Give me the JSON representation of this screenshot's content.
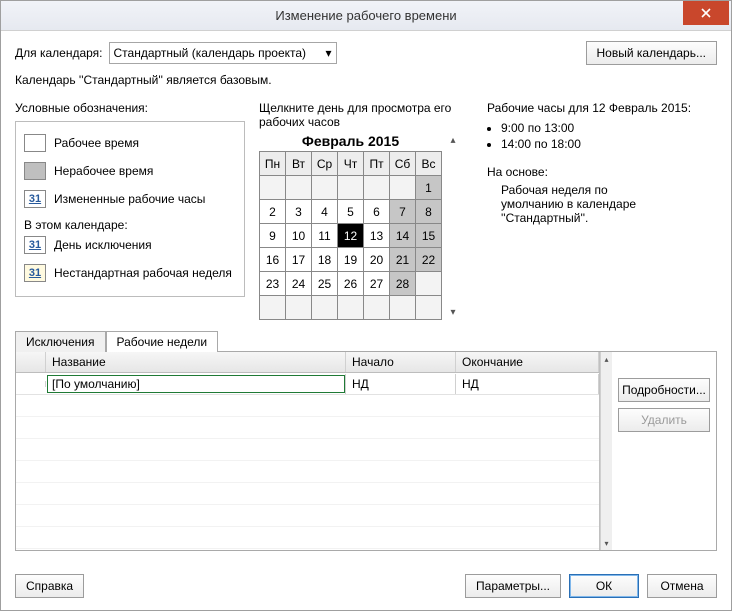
{
  "window": {
    "title": "Изменение рабочего времени"
  },
  "topbar": {
    "for_calendar_label": "Для календаря:",
    "calendar_selected": "Стандартный (календарь проекта)",
    "new_calendar_btn": "Новый календарь...",
    "base_text": "Календарь ''Стандартный'' является базовым."
  },
  "legend": {
    "header": "Условные обозначения:",
    "working": "Рабочее время",
    "nonworking": "Нерабочее время",
    "changed": "Измененные рабочие часы",
    "in_this_calendar": "В этом календаре:",
    "exception_day": "День исключения",
    "nonstandard_week": "Нестандартная рабочая неделя",
    "num": "31"
  },
  "calendar": {
    "hint": "Щелкните день для просмотра его рабочих часов",
    "month_title": "Февраль 2015",
    "weekdays": [
      "Пн",
      "Вт",
      "Ср",
      "Чт",
      "Пт",
      "Сб",
      "Вс"
    ],
    "weeks": [
      [
        {
          "d": "",
          "cls": "empty"
        },
        {
          "d": "",
          "cls": "empty"
        },
        {
          "d": "",
          "cls": "empty"
        },
        {
          "d": "",
          "cls": "empty"
        },
        {
          "d": "",
          "cls": "empty"
        },
        {
          "d": "",
          "cls": "empty"
        },
        {
          "d": "1",
          "cls": "wk"
        }
      ],
      [
        {
          "d": "2"
        },
        {
          "d": "3"
        },
        {
          "d": "4"
        },
        {
          "d": "5"
        },
        {
          "d": "6"
        },
        {
          "d": "7",
          "cls": "wk"
        },
        {
          "d": "8",
          "cls": "wk"
        }
      ],
      [
        {
          "d": "9"
        },
        {
          "d": "10"
        },
        {
          "d": "11"
        },
        {
          "d": "12",
          "cls": "sel"
        },
        {
          "d": "13"
        },
        {
          "d": "14",
          "cls": "wk"
        },
        {
          "d": "15",
          "cls": "wk"
        }
      ],
      [
        {
          "d": "16"
        },
        {
          "d": "17"
        },
        {
          "d": "18"
        },
        {
          "d": "19"
        },
        {
          "d": "20"
        },
        {
          "d": "21",
          "cls": "wk"
        },
        {
          "d": "22",
          "cls": "wk"
        }
      ],
      [
        {
          "d": "23"
        },
        {
          "d": "24"
        },
        {
          "d": "25"
        },
        {
          "d": "26"
        },
        {
          "d": "27"
        },
        {
          "d": "28",
          "cls": "wk"
        },
        {
          "d": "",
          "cls": "empty"
        }
      ],
      [
        {
          "d": "",
          "cls": "empty"
        },
        {
          "d": "",
          "cls": "empty"
        },
        {
          "d": "",
          "cls": "empty"
        },
        {
          "d": "",
          "cls": "empty"
        },
        {
          "d": "",
          "cls": "empty"
        },
        {
          "d": "",
          "cls": "empty"
        },
        {
          "d": "",
          "cls": "empty"
        }
      ]
    ]
  },
  "detail": {
    "header": "Рабочие часы для 12 Февраль 2015:",
    "slots": [
      "9:00 по 13:00",
      "14:00 по 18:00"
    ],
    "based_on_label": "На основе:",
    "based_on_text": "Рабочая неделя по умолчанию в календаре ''Стандартный''."
  },
  "tabs": {
    "exceptions": "Исключения",
    "workweeks": "Рабочие недели"
  },
  "table": {
    "cols": {
      "name": "Название",
      "start": "Начало",
      "finish": "Окончание"
    },
    "rows": [
      {
        "name": "[По умолчанию]",
        "start": "НД",
        "finish": "НД"
      }
    ]
  },
  "side": {
    "details": "Подробности...",
    "delete": "Удалить"
  },
  "footer": {
    "help": "Справка",
    "options": "Параметры...",
    "ok": "ОК",
    "cancel": "Отмена"
  }
}
